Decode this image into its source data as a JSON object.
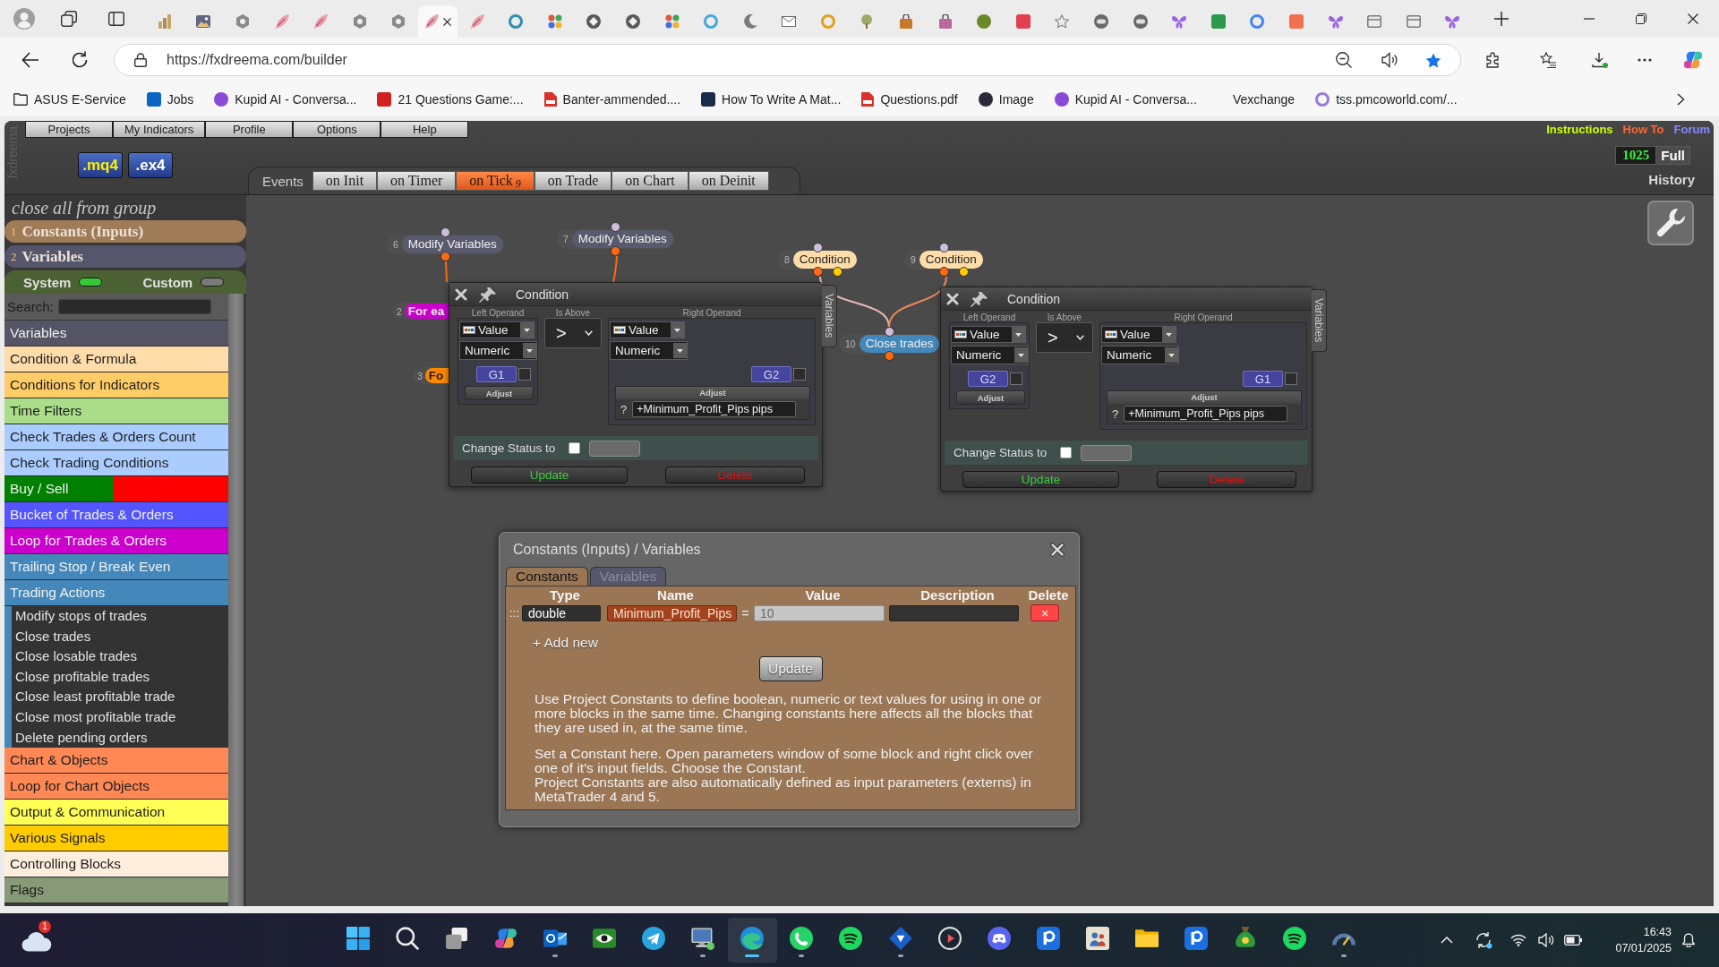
{
  "browser": {
    "tabs": [
      {
        "selected": false
      },
      {
        "selected": false
      },
      {
        "selected": false
      },
      {
        "selected": false
      },
      {
        "selected": false
      },
      {
        "selected": false
      },
      {
        "selected": false
      },
      {
        "selected": true
      },
      {
        "selected": false
      },
      {
        "selected": false
      },
      {
        "selected": false
      },
      {
        "selected": false
      },
      {
        "selected": false
      },
      {
        "selected": false
      },
      {
        "selected": false
      },
      {
        "selected": false
      },
      {
        "selected": false
      },
      {
        "selected": false
      },
      {
        "selected": false
      },
      {
        "selected": false
      },
      {
        "selected": false
      },
      {
        "selected": false
      },
      {
        "selected": false
      },
      {
        "selected": false
      },
      {
        "selected": false
      },
      {
        "selected": false
      },
      {
        "selected": false
      },
      {
        "selected": false
      },
      {
        "selected": false
      },
      {
        "selected": false
      },
      {
        "selected": false
      },
      {
        "selected": false
      },
      {
        "selected": false
      },
      {
        "selected": false
      }
    ],
    "address": "https://fxdreema.com/builder",
    "bookmarks": [
      "ASUS E-Service",
      "Jobs",
      "Kupid AI - Conversa...",
      "21 Questions Game:...",
      "Banter-ammended....",
      "How To Write A Mat...",
      "Questions.pdf",
      "Image",
      "Kupid AI - Conversa...",
      "Vexchange",
      "tss.pmcoworld.com/..."
    ]
  },
  "app": {
    "brand": "fxdreema",
    "menu": [
      "Projects",
      "My Indicators",
      "Profile",
      "Options",
      "Help"
    ],
    "file_buttons": [
      {
        "label": ".mq4",
        "color": "#ffee00"
      },
      {
        "label": ".ex4",
        "color": "#ffffff"
      }
    ],
    "events_label": "Events",
    "event_tabs": [
      {
        "label": "on Init",
        "selected": false
      },
      {
        "label": "on Timer",
        "selected": false
      },
      {
        "label": "on Tick",
        "selected": true,
        "count": "9"
      },
      {
        "label": "on Trade",
        "selected": false
      },
      {
        "label": "on Chart",
        "selected": false
      },
      {
        "label": "on Deinit",
        "selected": false
      }
    ],
    "links": [
      {
        "label": "Instructions",
        "color": "#ccff00"
      },
      {
        "label": "How To",
        "color": "#ff6633"
      },
      {
        "label": "Forum",
        "color": "#8888ff"
      }
    ],
    "counter": "1025",
    "full_button": "Full",
    "history": "History"
  },
  "sidebar": {
    "project": "close all from group",
    "sections": [
      {
        "number": "1",
        "label": "Constants (Inputs)",
        "color": "#a07b58"
      },
      {
        "number": "2",
        "label": "Variables",
        "color": "#55556b"
      }
    ],
    "toggles": [
      {
        "label": "System",
        "on": true
      },
      {
        "label": "Custom",
        "on": false
      }
    ],
    "search_label": "Search:",
    "categories": [
      {
        "label": "Variables",
        "color": "#555566"
      },
      {
        "label": "Condition & Formula",
        "color": "#ffddaa"
      },
      {
        "label": "Conditions for Indicators",
        "color": "#ffcc66"
      },
      {
        "label": "Time Filters",
        "color": "#aadd88"
      },
      {
        "label": "Check Trades & Orders Count",
        "color": "#aaccff"
      },
      {
        "label": "Check Trading Conditions",
        "color": "#aaccff"
      },
      {
        "label": "Buy / Sell",
        "halves": [
          {
            "color": "#008000"
          },
          {
            "color": "#ff0000"
          }
        ]
      },
      {
        "label": "Bucket of Trades & Orders",
        "color": "#5555ff"
      },
      {
        "label": "Loop for Trades & Orders",
        "color": "#cc00cc"
      },
      {
        "label": "Trailing Stop / Break Even",
        "color": "#4488bb"
      },
      {
        "label": "Trading Actions",
        "color": "#4488bb",
        "children": [
          {
            "label": "Modify stops of trades"
          },
          {
            "label": "Close trades"
          },
          {
            "label": "Close losable trades"
          },
          {
            "label": "Close profitable trades"
          },
          {
            "label": "Close least profitable trade"
          },
          {
            "label": "Close most profitable trade"
          },
          {
            "label": "Delete pending orders"
          }
        ]
      },
      {
        "label": "Chart & Objects",
        "color": "#ff8855"
      },
      {
        "label": "Loop for Chart Objects",
        "color": "#ff8855"
      },
      {
        "label": "Output & Communication",
        "color": "#ffff55"
      },
      {
        "label": "Various Signals",
        "color": "#ffcc00"
      },
      {
        "label": "Controlling Blocks",
        "color": "#ffeedd"
      },
      {
        "label": "Flags",
        "color": "#889977"
      }
    ]
  },
  "canvas": {
    "nodes": [
      {
        "number": "7",
        "label": "Modify Variables",
        "color": "#5a5a6e"
      },
      {
        "number": "6",
        "label": "Modify Variables",
        "color": "#5a5a6e"
      },
      {
        "number": "8",
        "label": "Condition",
        "color": "#ffddaa"
      },
      {
        "number": "9",
        "label": "Condition",
        "color": "#ffddaa"
      },
      {
        "number": "2",
        "label": "For ea",
        "color": "#cc00cc"
      },
      {
        "number": "10",
        "label": "Close trades",
        "color": "#4488bb"
      },
      {
        "number": "3",
        "label": "Fo",
        "color": "#ff8800"
      }
    ],
    "conditions": [
      {
        "title": "Condition",
        "side_tab": "Variables",
        "headings": [
          "Left Operand",
          "Is Above",
          "Right Operand"
        ],
        "left": {
          "type": "Value",
          "format": "Numeric",
          "group": "G1",
          "group_checked": false,
          "adjust": "Adjust"
        },
        "operator": ">",
        "right": {
          "type": "Value",
          "format": "Numeric",
          "group": "G2",
          "group_checked": false,
          "adjust": "Adjust",
          "help": "?",
          "adjust_value": "+Minimum_Profit_Pips pips"
        },
        "status_label": "Change Status to",
        "status_checked": false,
        "buttons": [
          {
            "label": "Update",
            "kind": "update"
          },
          {
            "label": "Delete",
            "kind": "delete"
          }
        ]
      },
      {
        "title": "Condition",
        "side_tab": "Variables",
        "headings": [
          "Left Operand",
          "Is Above",
          "Right Operand"
        ],
        "left": {
          "type": "Value",
          "format": "Numeric",
          "group": "G2",
          "group_checked": false,
          "adjust": "Adjust"
        },
        "operator": ">",
        "right": {
          "type": "Value",
          "format": "Numeric",
          "group": "G1",
          "group_checked": false,
          "adjust": "Adjust",
          "help": "?",
          "adjust_value": "+Minimum_Profit_Pips pips"
        },
        "status_label": "Change Status to",
        "status_checked": false,
        "buttons": [
          {
            "label": "Update",
            "kind": "update"
          },
          {
            "label": "Delete",
            "kind": "delete"
          }
        ]
      }
    ]
  },
  "dialog": {
    "title": "Constants (Inputs) / Variables",
    "tabs": [
      {
        "label": "Constants",
        "selected": true
      },
      {
        "label": "Variables",
        "selected": false
      }
    ],
    "columns": [
      "Type",
      "Name",
      "Value",
      "Description",
      "Delete"
    ],
    "rows": [
      {
        "handle": ":::",
        "type": "double",
        "name": "Minimum_Profit_Pips",
        "equals": "=",
        "value": "10",
        "delete": "×"
      }
    ],
    "add_new": "+ Add new",
    "update": "Update",
    "notes": [
      [
        "Use Project Constants to define boolean, numeric or text values for using in one or more blocks in the same time. Changing constants here affects all the blocks that they are used in, at the same time."
      ],
      [
        "Set a Constant here. Open parameters window of some block and right click over one of it's input fields. Choose the Constant.",
        "Project Constants are also automatically defined as input parameters (externs) in MetaTrader 4 and 5."
      ]
    ]
  },
  "taskbar": {
    "weather_badge": "1",
    "apps": [
      {
        "running": false,
        "selected": false
      },
      {
        "running": false,
        "selected": false
      },
      {
        "running": false,
        "selected": false
      },
      {
        "running": false,
        "selected": false
      },
      {
        "running": true,
        "selected": false
      },
      {
        "running": false,
        "selected": false
      },
      {
        "running": false,
        "selected": false
      },
      {
        "running": true,
        "selected": false
      },
      {
        "running": true,
        "selected": true
      },
      {
        "running": true,
        "selected": false
      },
      {
        "running": false,
        "selected": false
      },
      {
        "running": true,
        "selected": false
      },
      {
        "running": false,
        "selected": false
      },
      {
        "running": false,
        "selected": false
      },
      {
        "running": false,
        "selected": false
      },
      {
        "running": false,
        "selected": false
      },
      {
        "running": false,
        "selected": false
      },
      {
        "running": false,
        "selected": false
      },
      {
        "running": false,
        "selected": false
      },
      {
        "running": false,
        "selected": false
      },
      {
        "running": true,
        "selected": false
      }
    ],
    "time": "16:43",
    "date": "07/01/2025"
  }
}
